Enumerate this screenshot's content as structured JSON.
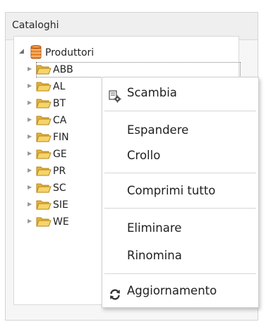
{
  "panel": {
    "title": "Cataloghi"
  },
  "tree": {
    "root": {
      "label": "Produttori",
      "icon": "database-icon",
      "expanded": true
    },
    "children": [
      {
        "label": "ABB",
        "icon": "folder-open-icon"
      },
      {
        "label": "AL",
        "icon": "folder-open-icon"
      },
      {
        "label": "BT",
        "icon": "folder-open-icon"
      },
      {
        "label": "CA",
        "icon": "folder-open-icon"
      },
      {
        "label": "FIN",
        "icon": "folder-open-icon"
      },
      {
        "label": "GE",
        "icon": "folder-open-icon"
      },
      {
        "label": "PR",
        "icon": "folder-open-icon"
      },
      {
        "label": "SC",
        "icon": "folder-open-icon"
      },
      {
        "label": "SIE",
        "icon": "folder-open-icon"
      },
      {
        "label": "WE",
        "icon": "folder-open-icon"
      }
    ]
  },
  "context_menu": {
    "items": [
      {
        "label": "Scambia",
        "icon": "swap-settings-icon"
      },
      {
        "label": "Espandere"
      },
      {
        "label": "Crollo"
      },
      {
        "label": "Comprimi tutto"
      },
      {
        "label": "Eliminare"
      },
      {
        "label": "Rinomina"
      },
      {
        "label": "Aggiornamento",
        "icon": "refresh-icon"
      }
    ]
  },
  "colors": {
    "folder": "#f0c44a",
    "database": "#e8842c",
    "menu_border": "#cfcfcf",
    "separator": "#d6d6d6"
  }
}
